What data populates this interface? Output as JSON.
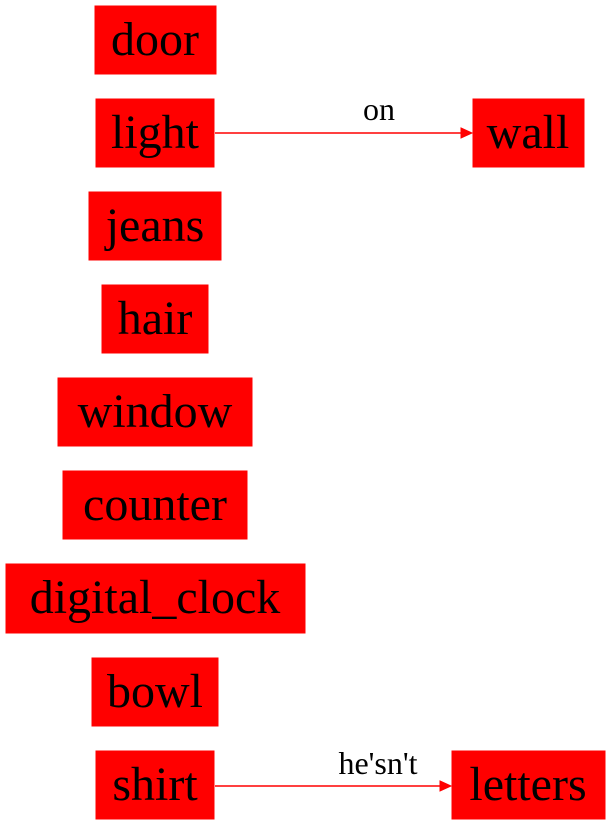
{
  "colors": {
    "node_fill": "#ff0000",
    "edge": "#ff0000",
    "text": "#000000",
    "background": "#ffffff"
  },
  "nodes": {
    "door": "door",
    "light": "light",
    "wall": "wall",
    "jeans": "jeans",
    "hair": "hair",
    "window": "window",
    "counter": "counter",
    "digital_clock": "digital_clock",
    "bowl": "bowl",
    "shirt": "shirt",
    "letters": "letters"
  },
  "edges": [
    {
      "from": "light",
      "to": "wall",
      "label": "on"
    },
    {
      "from": "shirt",
      "to": "letters",
      "label": "he'sn't"
    }
  ]
}
